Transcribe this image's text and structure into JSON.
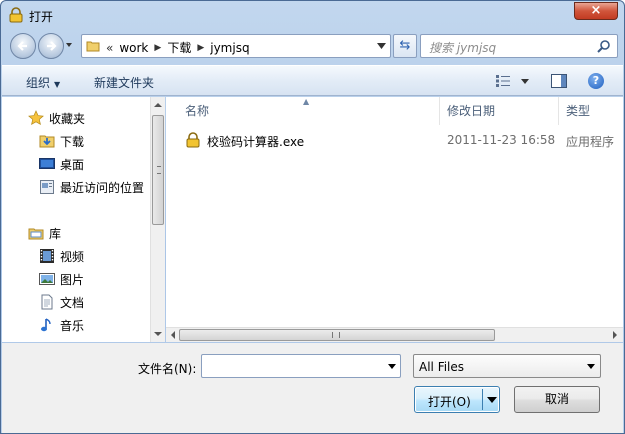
{
  "window": {
    "title": "打开",
    "close_glyph": "×"
  },
  "address": {
    "overflow": "«",
    "crumbs": [
      "work",
      "下载",
      "jymjsq"
    ]
  },
  "search": {
    "placeholder": "搜索 jymjsq"
  },
  "toolbar": {
    "organize": "组织",
    "new_folder": "新建文件夹",
    "help": "?"
  },
  "nav_pane": {
    "favorites": {
      "label": "收藏夹",
      "items": [
        "下载",
        "桌面",
        "最近访问的位置"
      ]
    },
    "libraries": {
      "label": "库",
      "items": [
        "视频",
        "图片",
        "文档",
        "音乐"
      ]
    }
  },
  "columns": {
    "name": "名称",
    "modified": "修改日期",
    "type": "类型"
  },
  "files": [
    {
      "name": "校验码计算器.exe",
      "modified": "2011-11-23 16:58",
      "type": "应用程序"
    }
  ],
  "bottom": {
    "filename_label": "文件名(N):",
    "filename_value": "",
    "filetype_value": "All Files",
    "open_button": "打开(O)",
    "cancel_button": "取消"
  },
  "colors": {
    "accent": "#3c7fb1",
    "header_text": "#4c607a",
    "toolbar_text": "#1e395b"
  }
}
